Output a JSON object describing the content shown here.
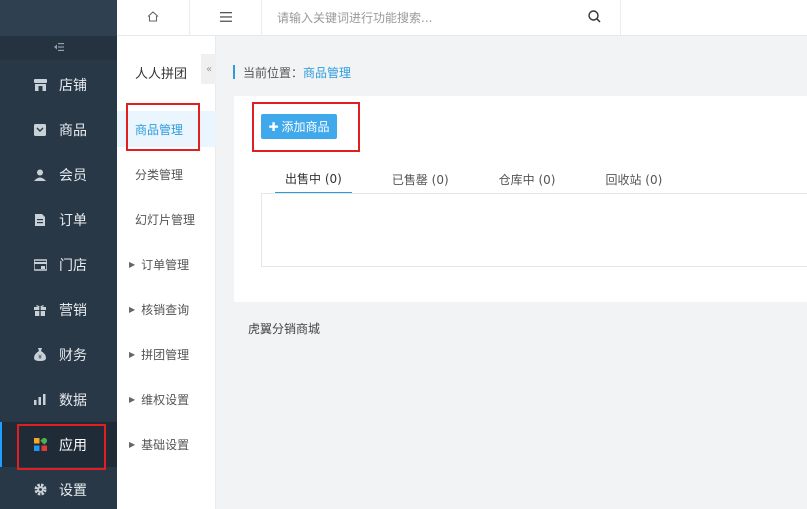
{
  "header": {
    "home_icon": "home-icon",
    "menu_icon": "hamburger-icon",
    "search_placeholder": "请输入关键词进行功能搜索...",
    "search_icon": "search-icon"
  },
  "sidebar": {
    "collapse_icon": "collapse-icon",
    "items": [
      {
        "label": "店铺",
        "icon": "store-icon"
      },
      {
        "label": "商品",
        "icon": "goods-icon"
      },
      {
        "label": "会员",
        "icon": "user-icon"
      },
      {
        "label": "订单",
        "icon": "order-icon"
      },
      {
        "label": "门店",
        "icon": "shop-icon"
      },
      {
        "label": "营销",
        "icon": "gift-icon"
      },
      {
        "label": "财务",
        "icon": "money-bag-icon"
      },
      {
        "label": "数据",
        "icon": "chart-icon"
      },
      {
        "label": "应用",
        "icon": "apps-icon"
      },
      {
        "label": "设置",
        "icon": "gear-icon"
      }
    ],
    "active_index": 8
  },
  "subnav": {
    "title": "人人拼团",
    "items": [
      {
        "label": "商品管理",
        "active": true
      },
      {
        "label": "分类管理"
      },
      {
        "label": "幻灯片管理"
      },
      {
        "label": "订单管理",
        "expandable": true
      },
      {
        "label": "核销查询",
        "expandable": true
      },
      {
        "label": "拼团管理",
        "expandable": true
      },
      {
        "label": "维权设置",
        "expandable": true
      },
      {
        "label": "基础设置",
        "expandable": true
      }
    ]
  },
  "breadcrumb": {
    "prefix": "当前位置：",
    "current": "商品管理"
  },
  "main": {
    "add_button": "添加商品",
    "tabs": [
      {
        "label": "出售中 (0)",
        "active": true
      },
      {
        "label": "已售罄 (0)"
      },
      {
        "label": "仓库中 (0)"
      },
      {
        "label": "回收站 (0)"
      }
    ],
    "footer": "虎翼分销商城"
  },
  "colors": {
    "sidebar_bg": "#293846",
    "accent": "#2d9cdb",
    "button": "#40a9ec",
    "highlight_box": "#e02020"
  }
}
